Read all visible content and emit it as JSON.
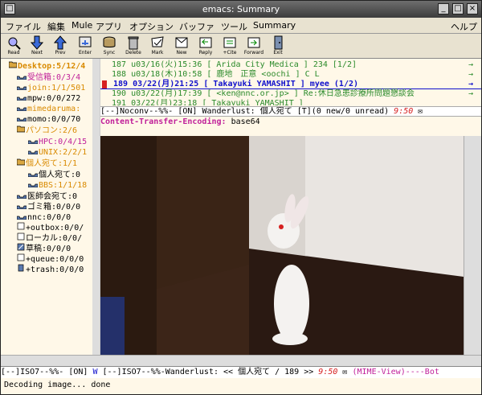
{
  "titlebar": {
    "title": "emacs: Summary"
  },
  "menubar": {
    "items": [
      "ファイル",
      "編集",
      "Mule",
      "アプリ",
      "オプション",
      "バッファ",
      "ツール",
      "Summary"
    ],
    "help": "ヘルプ"
  },
  "toolbar": {
    "buttons": [
      "Read",
      "Next",
      "Prev",
      "Enter",
      "Sync",
      "Delete",
      "Mark",
      "New",
      "Reply",
      "+Cite",
      "Forward",
      "Exit"
    ]
  },
  "folders": [
    {
      "label": "Desktop:5/12/4",
      "color": "orange",
      "icon": "folder-open-icon"
    },
    {
      "label": "受信箱:0/3/4",
      "color": "magenta",
      "icon": "inbox-icon"
    },
    {
      "label": "join:1/1/501",
      "color": "orange",
      "icon": "list-icon"
    },
    {
      "label": "mpw:0/0/272",
      "color": "black",
      "icon": "list-icon"
    },
    {
      "label": "mimedaruma:",
      "color": "orange",
      "icon": "list-icon"
    },
    {
      "label": "momo:0/0/70",
      "color": "black",
      "icon": "list-icon"
    },
    {
      "label": "パソコン:2/6",
      "color": "orange",
      "icon": "folder-open-icon"
    },
    {
      "label": "HPC:0/4/15",
      "color": "magenta",
      "icon": "list-icon"
    },
    {
      "label": "UNIX:2/2/1",
      "color": "orange",
      "icon": "list-icon"
    },
    {
      "label": "個人宛て:1/1",
      "color": "orange",
      "icon": "folder-open-icon"
    },
    {
      "label": "個人宛て:0",
      "color": "black",
      "icon": "list-icon"
    },
    {
      "label": "BBS:1/1/18",
      "color": "orange",
      "icon": "list-icon"
    },
    {
      "label": "医師会宛て:0",
      "color": "black",
      "icon": "list-icon"
    },
    {
      "label": "ゴミ箱:0/0/0",
      "color": "black",
      "icon": "list-icon"
    },
    {
      "label": "nnc:0/0/0",
      "color": "black",
      "icon": "list-icon"
    },
    {
      "label": "+outbox:0/0/",
      "color": "black",
      "icon": "box-icon"
    },
    {
      "label": "ローカル:0/0/",
      "color": "black",
      "icon": "box-icon"
    },
    {
      "label": "草稿:0/0/0",
      "color": "black",
      "icon": "draft-icon"
    },
    {
      "label": "+queue:0/0/0",
      "color": "black",
      "icon": "box-icon"
    },
    {
      "label": "+trash:0/0/0",
      "color": "black",
      "icon": "trash-icon"
    }
  ],
  "summary": [
    {
      "text": "187 u03/16(火)15:36 [ Arida City Medica ] 234 [1/2]",
      "color": "green",
      "current": false
    },
    {
      "text": "188 u03/18(木)10:58 [ 鹿地　正意 <oochi ] C L",
      "color": "green",
      "current": false
    },
    {
      "text": "189  03/22(月)21:25 [ Takayuki YAMASHIT ] myee (1/2)",
      "color": "blue",
      "current": true
    },
    {
      "text": "190 u03/22(月)17:39 [ <ken@nnc.or.jp>  ] Re:休日急患診療所問題懇談会",
      "color": "green",
      "current": false
    },
    {
      "text": "191  03/22(月)23:18 [ Takayuki YAMASHIT ]",
      "color": "green",
      "current": false
    }
  ],
  "modeline_top": {
    "left": "[--]Noconv--%%-",
    "on": "[ON]",
    "name": "Wanderlust: 個人宛て",
    "rest": "[T](0 new/0 unread)",
    "time": "9:50"
  },
  "message_header": {
    "key": "Content-Transfer-Encoding:",
    "value": "base64"
  },
  "modeline_bottom": {
    "left": "[--]ISO7--%%-",
    "on": "[ON]",
    "w": "W",
    "mid": "[--]ISO7--%%-Wanderlust: <<  個人宛て / 189 >>",
    "time": "9:50",
    "right": "(MIME-View)----Bot"
  },
  "echo": "Decoding image... done"
}
